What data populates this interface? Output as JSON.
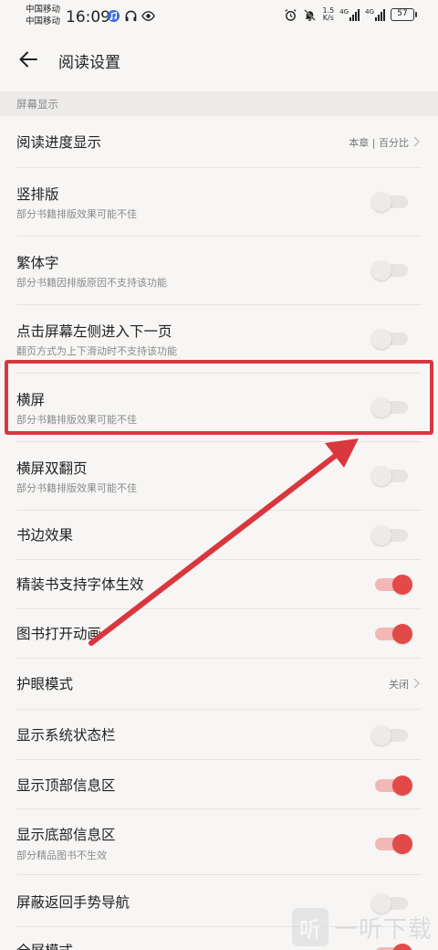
{
  "status_bar": {
    "carrier_1": "中国移动",
    "carrier_2": "中国移动",
    "time": "16:09",
    "net_speed_value": "1.5",
    "net_speed_unit": "K/s",
    "signal_1_label": "4G",
    "signal_2_label": "4G",
    "battery_level": "57"
  },
  "app_bar": {
    "title": "阅读设置"
  },
  "section": {
    "header": "屏幕显示"
  },
  "settings": [
    {
      "title": "阅读进度显示",
      "value": "本章 | 百分比"
    },
    {
      "title": "竖排版",
      "subtitle": "部分书籍排版效果可能不佳",
      "enabled": false
    },
    {
      "title": "繁体字",
      "subtitle": "部分书籍因排版原因不支持该功能",
      "enabled": false
    },
    {
      "title": "点击屏幕左侧进入下一页",
      "subtitle": "翻页方式为上下滑动时不支持该功能",
      "enabled": false
    },
    {
      "title": "横屏",
      "subtitle": "部分书籍排版效果可能不佳",
      "enabled": false
    },
    {
      "title": "横屏双翻页",
      "subtitle": "部分书籍排版效果可能不佳",
      "enabled": false
    },
    {
      "title": "书边效果",
      "enabled": false
    },
    {
      "title": "精装书支持字体生效",
      "enabled": true
    },
    {
      "title": "图书打开动画",
      "enabled": true
    },
    {
      "title": "护眼模式",
      "value": "关闭"
    },
    {
      "title": "显示系统状态栏",
      "enabled": false
    },
    {
      "title": "显示顶部信息区",
      "enabled": true
    },
    {
      "title": "显示底部信息区",
      "subtitle": "部分精品图书不生效",
      "enabled": true
    },
    {
      "title": "屏蔽返回手势导航",
      "enabled": false
    },
    {
      "title": "全屏模式",
      "enabled": true
    }
  ],
  "watermark": {
    "logo_glyph": "听",
    "text": "一听下载"
  },
  "colors": {
    "accent": "#e24a48",
    "annotation": "#d9373e",
    "background": "#f7f6f5"
  }
}
